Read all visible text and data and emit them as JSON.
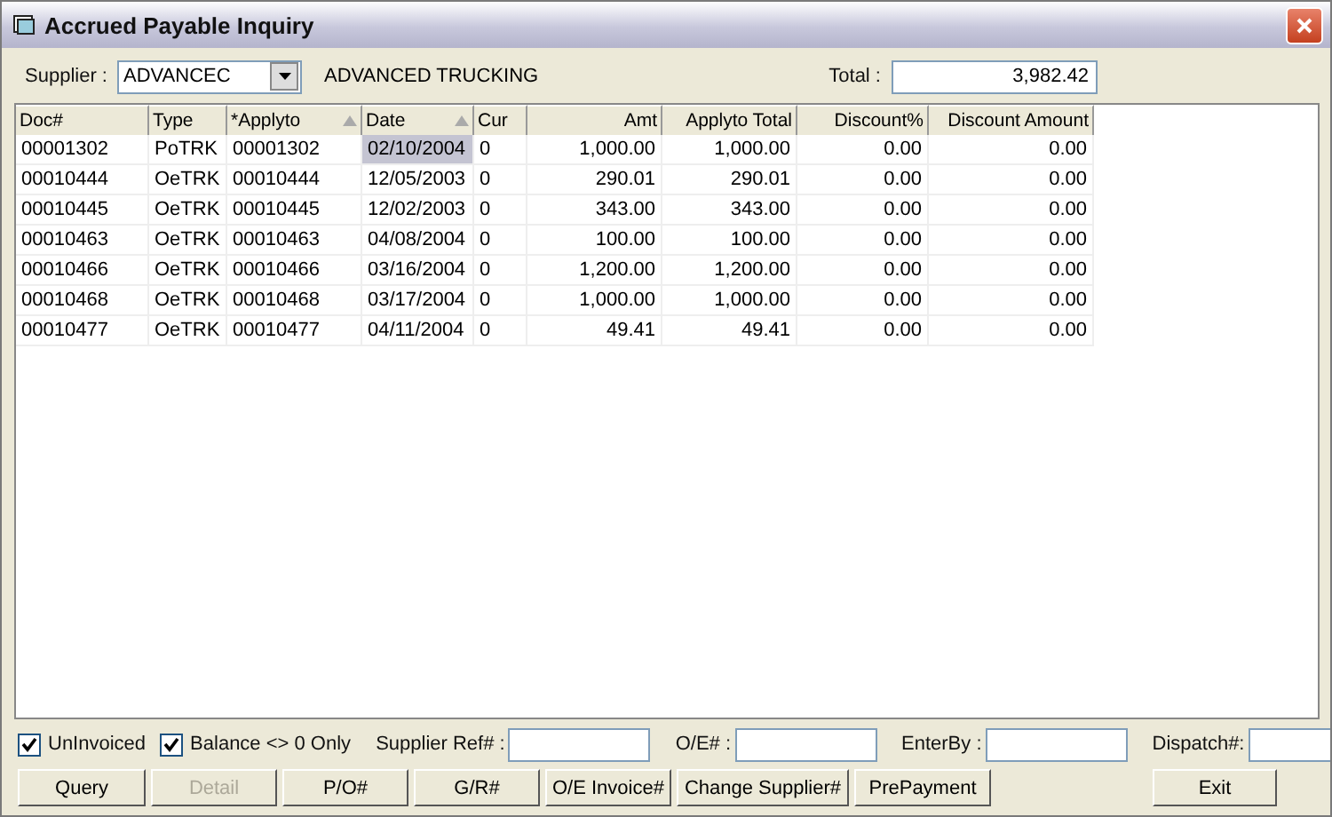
{
  "window": {
    "title": "Accrued Payable Inquiry"
  },
  "supplier": {
    "label": "Supplier :",
    "code": "ADVANCEC",
    "name": "ADVANCED TRUCKING"
  },
  "total": {
    "label": "Total :",
    "value": "3,982.42"
  },
  "table": {
    "columns": [
      {
        "label": "Doc#",
        "numeric": false,
        "sorted": false
      },
      {
        "label": "Type",
        "numeric": false,
        "sorted": false
      },
      {
        "label": "*Applyto",
        "numeric": false,
        "sorted": true
      },
      {
        "label": "Date",
        "numeric": false,
        "sorted": true
      },
      {
        "label": "Cur",
        "numeric": false,
        "sorted": false
      },
      {
        "label": "Amt",
        "numeric": true,
        "sorted": false
      },
      {
        "label": "Applyto Total",
        "numeric": true,
        "sorted": false
      },
      {
        "label": "Discount%",
        "numeric": true,
        "sorted": false
      },
      {
        "label": "Discount Amount",
        "numeric": true,
        "sorted": false
      }
    ],
    "rows": [
      {
        "cells": [
          {
            "text": "00001302",
            "selected": false
          },
          {
            "text": "PoTRK",
            "selected": false
          },
          {
            "text": "00001302",
            "selected": false
          },
          {
            "text": "02/10/2004",
            "selected": true
          },
          {
            "text": "0",
            "selected": false
          },
          {
            "text": "1,000.00",
            "selected": false
          },
          {
            "text": "1,000.00",
            "selected": false
          },
          {
            "text": "0.00",
            "selected": false
          },
          {
            "text": "0.00",
            "selected": false
          }
        ]
      },
      {
        "cells": [
          {
            "text": "00010444",
            "selected": false
          },
          {
            "text": "OeTRK",
            "selected": false
          },
          {
            "text": "00010444",
            "selected": false
          },
          {
            "text": "12/05/2003",
            "selected": false
          },
          {
            "text": "0",
            "selected": false
          },
          {
            "text": "290.01",
            "selected": false
          },
          {
            "text": "290.01",
            "selected": false
          },
          {
            "text": "0.00",
            "selected": false
          },
          {
            "text": "0.00",
            "selected": false
          }
        ]
      },
      {
        "cells": [
          {
            "text": "00010445",
            "selected": false
          },
          {
            "text": "OeTRK",
            "selected": false
          },
          {
            "text": "00010445",
            "selected": false
          },
          {
            "text": "12/02/2003",
            "selected": false
          },
          {
            "text": "0",
            "selected": false
          },
          {
            "text": "343.00",
            "selected": false
          },
          {
            "text": "343.00",
            "selected": false
          },
          {
            "text": "0.00",
            "selected": false
          },
          {
            "text": "0.00",
            "selected": false
          }
        ]
      },
      {
        "cells": [
          {
            "text": "00010463",
            "selected": false
          },
          {
            "text": "OeTRK",
            "selected": false
          },
          {
            "text": "00010463",
            "selected": false
          },
          {
            "text": "04/08/2004",
            "selected": false
          },
          {
            "text": "0",
            "selected": false
          },
          {
            "text": "100.00",
            "selected": false
          },
          {
            "text": "100.00",
            "selected": false
          },
          {
            "text": "0.00",
            "selected": false
          },
          {
            "text": "0.00",
            "selected": false
          }
        ]
      },
      {
        "cells": [
          {
            "text": "00010466",
            "selected": false
          },
          {
            "text": "OeTRK",
            "selected": false
          },
          {
            "text": "00010466",
            "selected": false
          },
          {
            "text": "03/16/2004",
            "selected": false
          },
          {
            "text": "0",
            "selected": false
          },
          {
            "text": "1,200.00",
            "selected": false
          },
          {
            "text": "1,200.00",
            "selected": false
          },
          {
            "text": "0.00",
            "selected": false
          },
          {
            "text": "0.00",
            "selected": false
          }
        ]
      },
      {
        "cells": [
          {
            "text": "00010468",
            "selected": false
          },
          {
            "text": "OeTRK",
            "selected": false
          },
          {
            "text": "00010468",
            "selected": false
          },
          {
            "text": "03/17/2004",
            "selected": false
          },
          {
            "text": "0",
            "selected": false
          },
          {
            "text": "1,000.00",
            "selected": false
          },
          {
            "text": "1,000.00",
            "selected": false
          },
          {
            "text": "0.00",
            "selected": false
          },
          {
            "text": "0.00",
            "selected": false
          }
        ]
      },
      {
        "cells": [
          {
            "text": "00010477",
            "selected": false
          },
          {
            "text": "OeTRK",
            "selected": false
          },
          {
            "text": "00010477",
            "selected": false
          },
          {
            "text": "04/11/2004",
            "selected": false
          },
          {
            "text": "0",
            "selected": false
          },
          {
            "text": "49.41",
            "selected": false
          },
          {
            "text": "49.41",
            "selected": false
          },
          {
            "text": "0.00",
            "selected": false
          },
          {
            "text": "0.00",
            "selected": false
          }
        ]
      }
    ]
  },
  "filters": [
    {
      "kind": "checkbox",
      "label": "UnInvoiced",
      "checked": true
    },
    {
      "kind": "checkbox",
      "label": "Balance <> 0 Only",
      "checked": true
    },
    {
      "kind": "field",
      "label": "Supplier Ref# :"
    },
    {
      "kind": "field",
      "label": "O/E# :"
    },
    {
      "kind": "field",
      "label": "EnterBy :"
    },
    {
      "kind": "field",
      "label": "Dispatch#:"
    }
  ],
  "buttons": [
    {
      "label": "Query",
      "disabled": false
    },
    {
      "label": "Detail",
      "disabled": true
    },
    {
      "label": "P/O#",
      "disabled": false
    },
    {
      "label": "G/R#",
      "disabled": false
    },
    {
      "label": "O/E Invoice#",
      "disabled": false
    },
    {
      "label": "Change Supplier#",
      "disabled": false
    },
    {
      "label": "PrePayment",
      "disabled": false
    },
    {
      "label": "Exit",
      "disabled": false
    }
  ]
}
